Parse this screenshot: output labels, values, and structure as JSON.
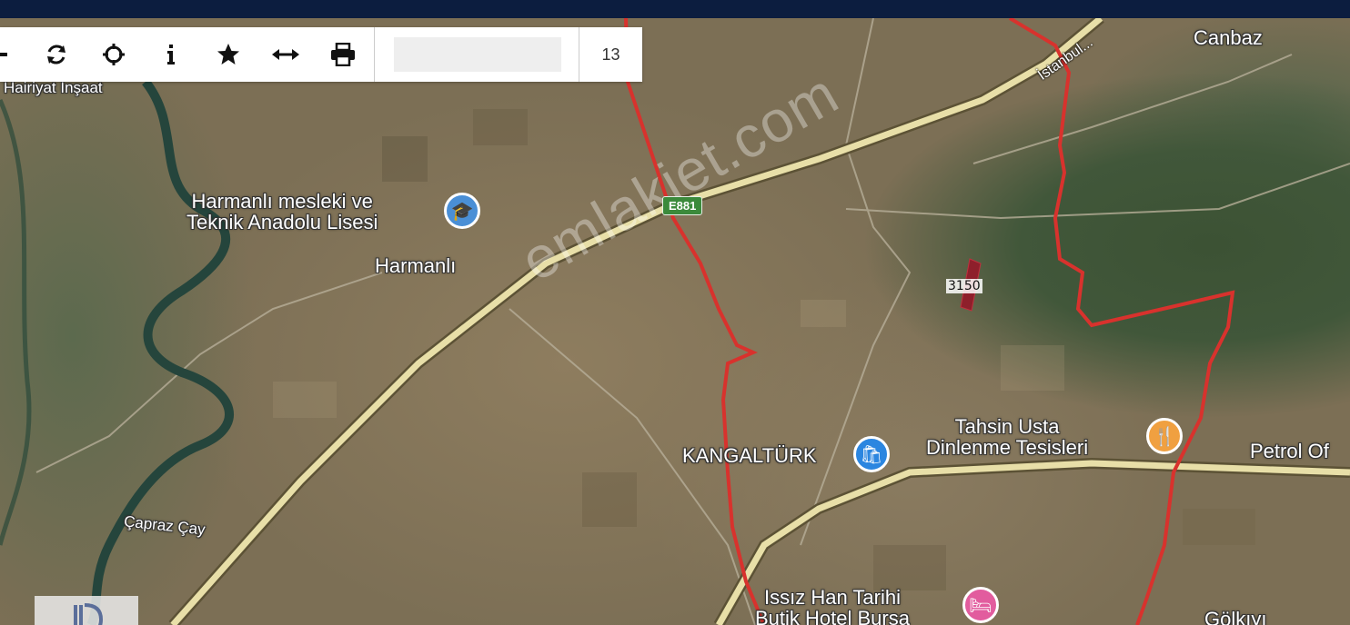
{
  "toolbar": {
    "buttons": [
      {
        "name": "minus-icon",
        "glyph": "−"
      },
      {
        "name": "refresh-icon",
        "glyph": "⟳"
      },
      {
        "name": "locate-icon",
        "glyph": "⌖"
      },
      {
        "name": "info-icon",
        "glyph": "i"
      },
      {
        "name": "star-icon",
        "glyph": "★"
      },
      {
        "name": "measure-icon",
        "glyph": "⟷"
      },
      {
        "name": "print-icon",
        "glyph": "⎙"
      }
    ],
    "search_value": "",
    "zoom_level": "13"
  },
  "map": {
    "places": {
      "hairiyat": "Hairiyat İnşaat",
      "school_line1": "Harmanlı mesleki ve",
      "school_line2": "Teknik Anadolu Lisesi",
      "harmanli": "Harmanlı",
      "canbaz": "Canbaz",
      "kangalturk": "KANGALTÜRK",
      "tahsin_line1": "Tahsin Usta",
      "tahsin_line2": "Dinlenme Tesisleri",
      "petrol": "Petrol Of",
      "capraz": "Çapraz Çay",
      "issiz_line1": "Issız Han Tarihi",
      "issiz_line2": "Butik Hotel Bursa",
      "golkuyu": "Gölkıyı"
    },
    "road_badge": "E881",
    "road_name": "İstanbul...",
    "parcel_label": "3150",
    "watermark": "emlakjet.com",
    "colors": {
      "boundary": "#d8322d",
      "highway": "#e8dfa8",
      "river": "#25453c",
      "parcel": "#8e1f2b",
      "school_pin": "#4a8fd6",
      "shop_pin": "#2b86e0",
      "food_pin": "#f0a040",
      "hotel_pin": "#e25c9e",
      "road_badge": "#3b8a3b"
    }
  }
}
